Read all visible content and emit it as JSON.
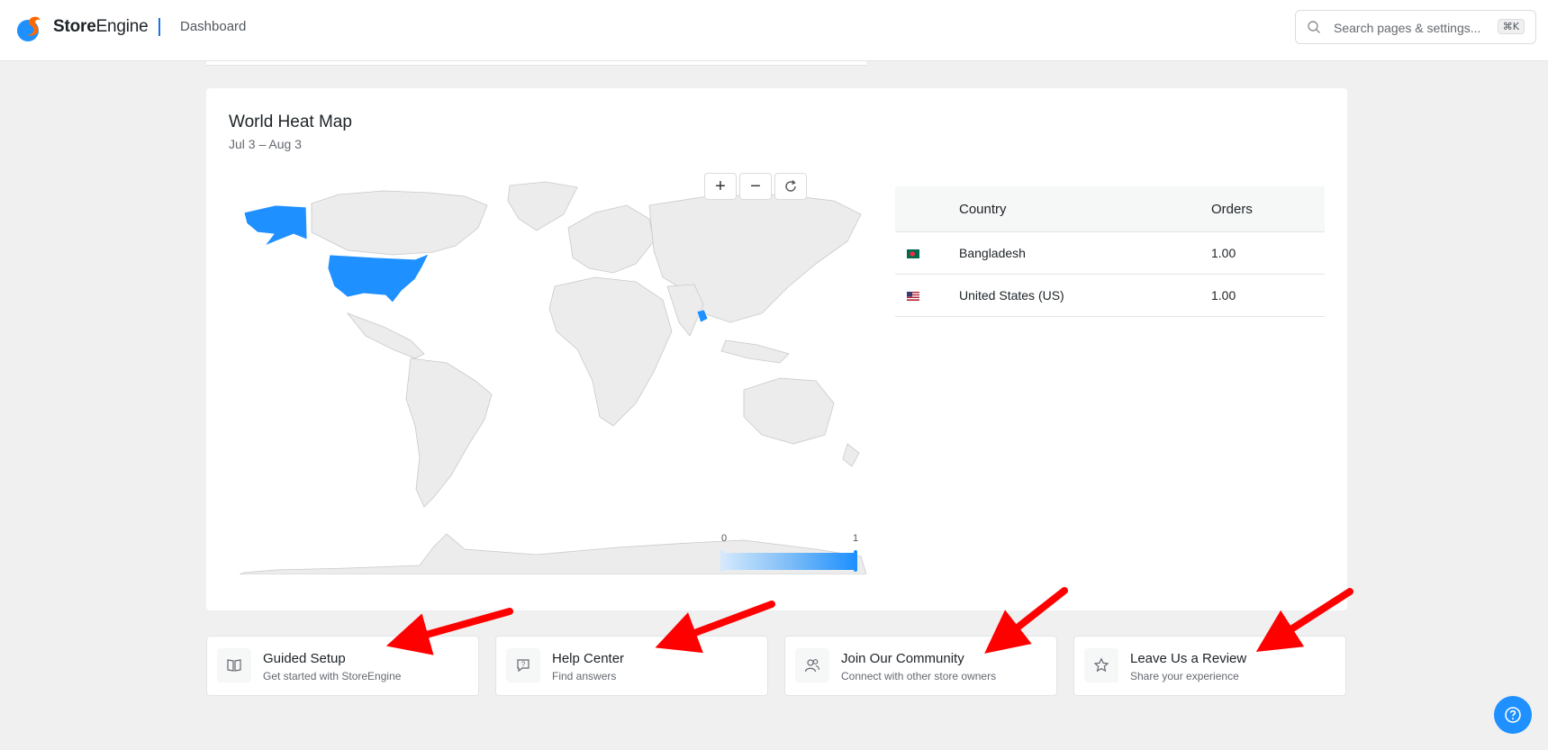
{
  "header": {
    "brand_bold": "Store",
    "brand_rest": "Engine",
    "breadcrumb": "Dashboard",
    "search_placeholder": "Search pages & settings...",
    "shortcut": "⌘K"
  },
  "map_card": {
    "title": "World Heat Map",
    "date_range": "Jul 3 – Aug 3",
    "zoom_in": "+",
    "zoom_out": "−",
    "legend": {
      "min": "0",
      "max": "1"
    },
    "highlighted_countries": [
      "United States",
      "Bangladesh"
    ],
    "highlight_color": "#1e90ff",
    "land_color": "#ececec"
  },
  "table": {
    "headers": [
      "Country",
      "Orders"
    ],
    "rows": [
      {
        "country": "Bangladesh",
        "orders": "1.00"
      },
      {
        "country": "United States (US)",
        "orders": "1.00"
      }
    ]
  },
  "quick_links": [
    {
      "title": "Guided Setup",
      "subtitle": "Get started with StoreEngine",
      "icon": "book-icon"
    },
    {
      "title": "Help Center",
      "subtitle": "Find answers",
      "icon": "chat-question-icon"
    },
    {
      "title": "Join Our Community",
      "subtitle": "Connect with other store owners",
      "icon": "users-icon"
    },
    {
      "title": "Leave Us a Review",
      "subtitle": "Share your experience",
      "icon": "star-icon"
    }
  ],
  "colors": {
    "accent": "#1e90ff",
    "annotation_arrow": "#ff0000"
  }
}
